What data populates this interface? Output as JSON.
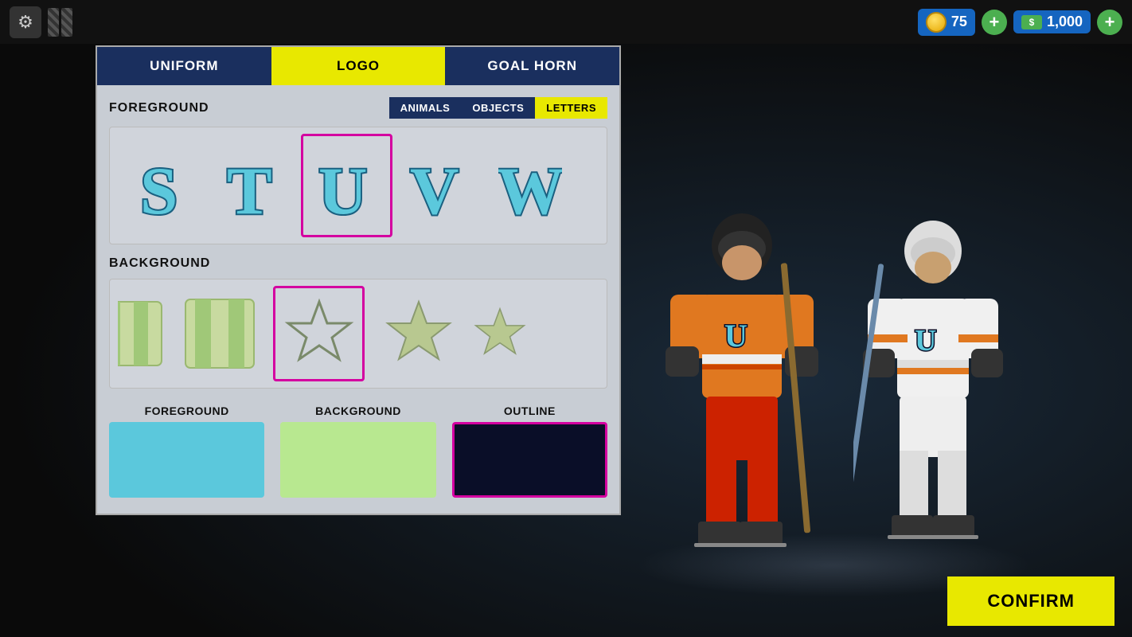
{
  "topbar": {
    "coin_amount": "75",
    "cash_amount": "1,000",
    "plus_label": "+",
    "add_coins_label": "+",
    "gear_label": "⚙"
  },
  "tabs": {
    "uniform": "UNIFORM",
    "logo": "LOGO",
    "goal_horn": "GOAL HORN",
    "active": "logo"
  },
  "foreground_section": {
    "label": "FOREGROUND"
  },
  "filter_buttons": {
    "animals": "ANIMALS",
    "objects": "OBJECTS",
    "letters": "LETTERS",
    "active": "letters"
  },
  "letters": [
    {
      "char": "S",
      "id": "S"
    },
    {
      "char": "T",
      "id": "T"
    },
    {
      "char": "U",
      "id": "U",
      "selected": true
    },
    {
      "char": "V",
      "id": "V"
    },
    {
      "char": "W",
      "id": "W"
    }
  ],
  "background_section": {
    "label": "BACKGROUND"
  },
  "shapes": [
    {
      "type": "stripe-double",
      "id": "shape1"
    },
    {
      "type": "stripe-single",
      "id": "shape2"
    },
    {
      "type": "star-outline",
      "id": "shape3",
      "selected": true
    },
    {
      "type": "star-filled",
      "id": "shape4"
    },
    {
      "type": "star-half",
      "id": "shape5"
    }
  ],
  "colors": {
    "foreground": {
      "label": "FOREGROUND",
      "value": "#5bc8dc"
    },
    "background": {
      "label": "BACKGROUND",
      "value": "#b8e890"
    },
    "outline": {
      "label": "OUTLINE",
      "value": "#0a0e28",
      "outlined": true
    }
  },
  "confirm_button": {
    "label": "CONFIRM"
  }
}
